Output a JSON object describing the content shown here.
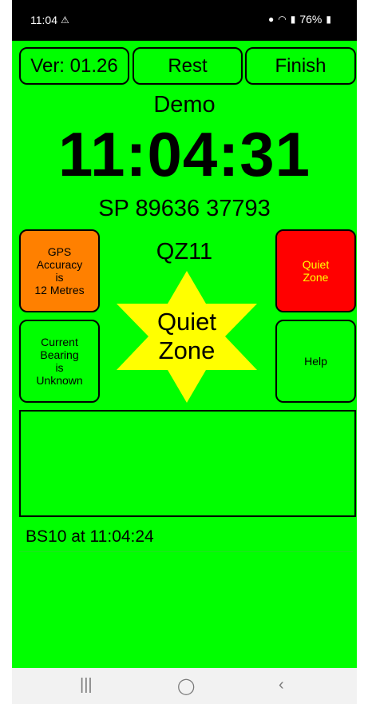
{
  "status_bar": {
    "time": "11:04",
    "battery": "76%",
    "icons": [
      "notification-icon",
      "location-icon",
      "wifi-icon",
      "signal-icon",
      "battery-icon"
    ]
  },
  "toolbar": {
    "version_label": "Ver: 01.26",
    "rest_label": "Rest",
    "finish_label": "Finish"
  },
  "main": {
    "mode": "Demo",
    "clock": "11:04:31",
    "grid_reference": "SP 89636 37793",
    "zone_code": "QZ11",
    "star_label_line1": "Quiet",
    "star_label_line2": "Zone"
  },
  "left_buttons": {
    "gps": [
      "GPS",
      "Accuracy",
      "is",
      "12 Metres"
    ],
    "bearing": [
      "Current",
      "Bearing",
      "is",
      "Unknown"
    ]
  },
  "right_buttons": {
    "quiet_zone": [
      "Quiet",
      "Zone"
    ],
    "help": "Help"
  },
  "log": {
    "last_entry": "BS10 at 11:04:24"
  },
  "colors": {
    "background": "#00ff00",
    "gps_button": "#ff8000",
    "quiet_zone_button": "#ff0000",
    "quiet_zone_text": "#ffff00",
    "star": "#ffff00"
  },
  "nav_bar": {
    "recent_glyph": "|||",
    "home_glyph": "◯",
    "back_glyph": "‹"
  }
}
